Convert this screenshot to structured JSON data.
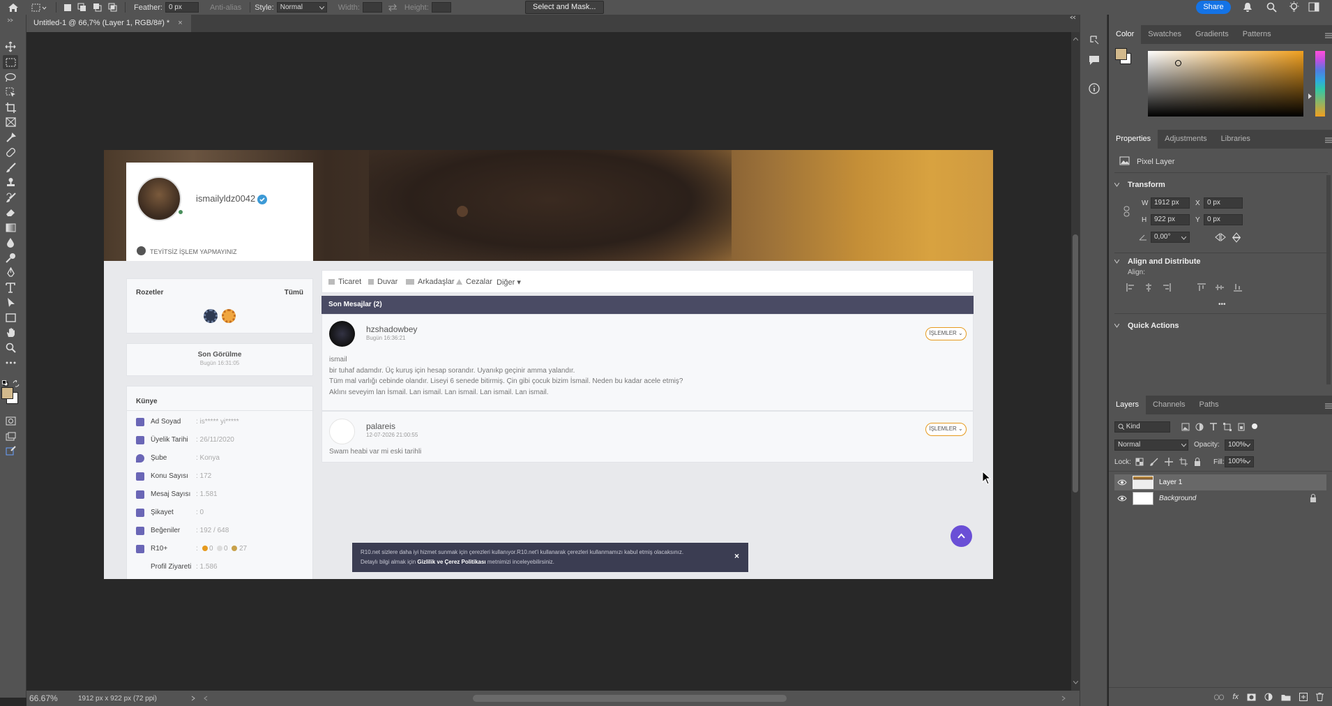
{
  "options_bar": {
    "feather_label": "Feather:",
    "feather_value": "0 px",
    "antialias_label": "Anti-alias",
    "style_label": "Style:",
    "style_value": "Normal",
    "width_label": "Width:",
    "height_label": "Height:",
    "select_mask_label": "Select and Mask...",
    "share_label": "Share"
  },
  "document_tab": {
    "title": "Untitled-1 @ 66,7% (Layer 1, RGB/8#) *",
    "close": "×"
  },
  "status_bar": {
    "zoom": "66.67%",
    "doc_info": "1912 px x 922 px (72 ppi)"
  },
  "colors": {
    "foreground": "#d2b98c",
    "background": "#ffffff",
    "accent": "#1473e6"
  },
  "color_panel": {
    "tabs": [
      "Color",
      "Swatches",
      "Gradients",
      "Patterns"
    ],
    "active": "Color"
  },
  "properties_panel": {
    "tabs": [
      "Properties",
      "Adjustments",
      "Libraries"
    ],
    "active": "Properties",
    "layer_type": "Pixel Layer",
    "transform_title": "Transform",
    "w_label": "W",
    "w_value": "1912 px",
    "h_label": "H",
    "h_value": "922 px",
    "x_label": "X",
    "x_value": "0 px",
    "y_label": "Y",
    "y_value": "0 px",
    "angle_value": "0,00°",
    "align_title": "Align and Distribute",
    "align_label": "Align:",
    "more": "•••",
    "quick_actions_title": "Quick Actions"
  },
  "layers_panel": {
    "tabs": [
      "Layers",
      "Channels",
      "Paths"
    ],
    "active": "Layers",
    "filter_value": "Kind",
    "blend_mode": "Normal",
    "opacity_label": "Opacity:",
    "opacity_value": "100%",
    "lock_label": "Lock:",
    "fill_label": "Fill:",
    "fill_value": "100%",
    "layers": [
      {
        "name": "Layer 1",
        "selected": true
      },
      {
        "name": "Background",
        "selected": false
      }
    ]
  },
  "web_page": {
    "username": "ismailyldz0042",
    "warning": "TEYİTSİZ İŞLEM YAPMAYINIZ",
    "badges_title": "Rozetler",
    "badges_all": "Tümü",
    "last_seen_title": "Son Görülme",
    "last_seen_value": "Bugün 16:31:05",
    "kunye_title": "Künye",
    "kunye": [
      {
        "label": "Ad Soyad",
        "value": ": is***** yi*****"
      },
      {
        "label": "Üyelik Tarihi",
        "value": ": 26/11/2020"
      },
      {
        "label": "Şube",
        "value": ": Konya"
      },
      {
        "label": "Konu Sayısı",
        "value": ": 172"
      },
      {
        "label": "Mesaj Sayısı",
        "value": ": 1.581"
      },
      {
        "label": "Şikayet",
        "value": ": 0"
      },
      {
        "label": "Beğeniler",
        "value": ": 192 / 648"
      },
      {
        "label": "R10+",
        "value": ":"
      },
      {
        "label": "Profil Ziyareti",
        "value": ": 1.586"
      }
    ],
    "r10_values": [
      "0",
      "0",
      "27"
    ],
    "nav_tabs": [
      "Ticaret",
      "Duvar",
      "Arkadaşlar",
      "Cezalar",
      "Diğer ▾"
    ],
    "messages_header": "Son Mesajlar (2)",
    "islemler_label": "İŞLEMLER ⌄",
    "messages": [
      {
        "author": "hzshadowbey",
        "time": "Bugün 16:36:21",
        "lines": [
          "ismail",
          "bir tuhaf adamdır. Üç kuruş için hesap sorandır. Uyanıkp geçinir amma yalandır.",
          "Tüm mal varlığı cebinde olandır. Liseyi 6 senede bitirmiş. Çin gibi çocuk bizim İsmail. Neden bu kadar acele etmiş?",
          "Aklını seveyim lan İsmail. Lan ismail. Lan ismail. Lan ismail. Lan ismail."
        ]
      },
      {
        "author": "palareis",
        "time": "12-07-2026 21:00:55",
        "lines": [
          "Swam heabi var mi eski tarihli"
        ]
      }
    ],
    "cookie_line1": "R10.net sizlere daha iyi hizmet sunmak için çerezleri kullanıyor.R10.net'i kullanarak çerezleri kullanmamızı kabul etmiş olacaksınız.",
    "cookie_line2_pre": "Detaylı bilgi almak için",
    "cookie_link": "Gizlilik ve Çerez Politikası",
    "cookie_line2_post": "metnimizi inceleyebilirsiniz.",
    "cookie_close": "×"
  }
}
